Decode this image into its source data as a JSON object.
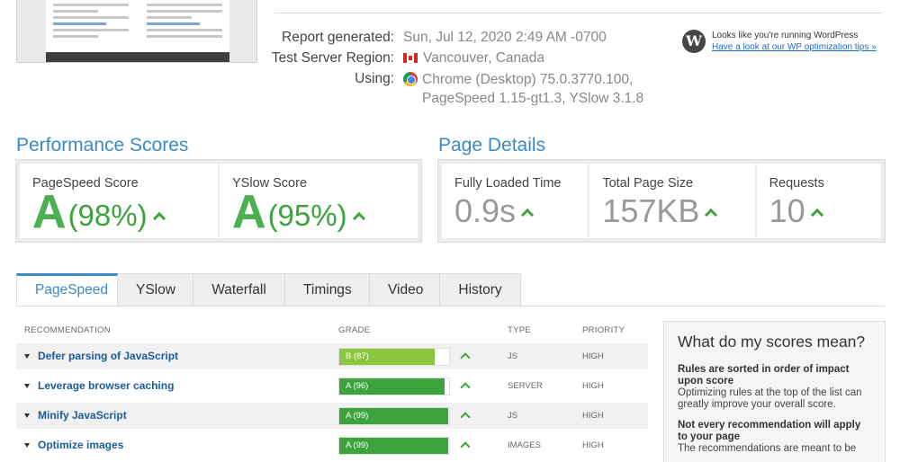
{
  "meta": {
    "report_generated_label": "Report generated:",
    "report_generated_value": "Sun, Jul 12, 2020 2:49 AM -0700",
    "region_label": "Test Server Region:",
    "region_value": "Vancouver, Canada",
    "using_label": "Using:",
    "using_value_line1": "Chrome (Desktop) 75.0.3770.100,",
    "using_value_line2": "PageSpeed 1.15-gt1.3, YSlow 3.1.8"
  },
  "wordpress": {
    "text": "Looks like you're running WordPress",
    "link": "Have a look at our WP optimization tips »"
  },
  "performance": {
    "title": "Performance Scores",
    "pagespeed_label": "PageSpeed Score",
    "pagespeed_grade": "A",
    "pagespeed_pct": "(98%)",
    "yslow_label": "YSlow Score",
    "yslow_grade": "A",
    "yslow_pct": "(95%)"
  },
  "details": {
    "title": "Page Details",
    "loaded_label": "Fully Loaded Time",
    "loaded_value": "0.9s",
    "size_label": "Total Page Size",
    "size_value": "157KB",
    "requests_label": "Requests",
    "requests_value": "10"
  },
  "tabs": [
    "PageSpeed",
    "YSlow",
    "Waterfall",
    "Timings",
    "Video",
    "History"
  ],
  "table": {
    "headers": {
      "recommendation": "RECOMMENDATION",
      "grade": "GRADE",
      "type": "TYPE",
      "priority": "PRIORITY"
    },
    "rows": [
      {
        "recommendation": "Defer parsing of JavaScript",
        "grade": "B (87)",
        "score": 87,
        "type": "JS",
        "priority": "HIGH"
      },
      {
        "recommendation": "Leverage browser caching",
        "grade": "A (96)",
        "score": 96,
        "type": "SERVER",
        "priority": "HIGH"
      },
      {
        "recommendation": "Minify JavaScript",
        "grade": "A (99)",
        "score": 99,
        "type": "JS",
        "priority": "HIGH"
      },
      {
        "recommendation": "Optimize images",
        "grade": "A (99)",
        "score": 99,
        "type": "IMAGES",
        "priority": "HIGH"
      }
    ]
  },
  "side": {
    "title": "What do my scores mean?",
    "h1": "Rules are sorted in order of impact upon score",
    "p1": "Optimizing rules at the top of the list can greatly improve your overall score.",
    "h2": "Not every recommendation will apply to your page",
    "p2": "The recommendations are meant to be"
  },
  "colors": {
    "accent": "#3a8ac9",
    "grade_a": "#3da33d",
    "grade_b": "#8cc63f"
  }
}
